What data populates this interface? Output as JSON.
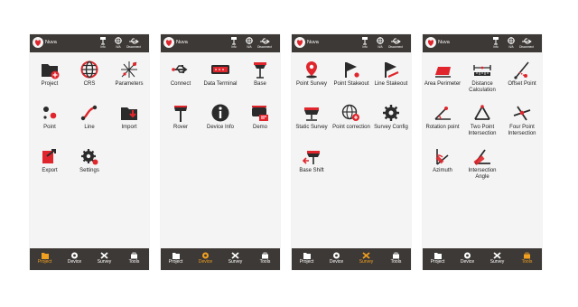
{
  "screens": [
    {
      "title": "Nuva",
      "header_buttons": [
        {
          "label": "Info",
          "icon": "tower-icon"
        },
        {
          "label": "N/A",
          "icon": "satellite-icon"
        },
        {
          "label": "Disconnect",
          "icon": "usb-icon"
        }
      ],
      "items": [
        {
          "label": "Project",
          "icon": "folder-add-icon"
        },
        {
          "label": "CRS",
          "icon": "globe-icon"
        },
        {
          "label": "Parameters",
          "icon": "parameters-icon"
        },
        {
          "label": "Point",
          "icon": "point-icon"
        },
        {
          "label": "Line",
          "icon": "line-icon"
        },
        {
          "label": "Import",
          "icon": "import-folder-icon"
        },
        {
          "label": "Export",
          "icon": "export-icon"
        },
        {
          "label": "Settings",
          "icon": "settings-gear-icon"
        }
      ],
      "active_tab": 0
    },
    {
      "title": "Nuva",
      "header_buttons": [
        {
          "label": "Info",
          "icon": "tower-icon"
        },
        {
          "label": "N/A",
          "icon": "satellite-icon"
        },
        {
          "label": "Disconnect",
          "icon": "usb-icon"
        }
      ],
      "items": [
        {
          "label": "Connect",
          "icon": "usb-connect-icon"
        },
        {
          "label": "Data Terminal",
          "icon": "terminal-icon"
        },
        {
          "label": "Base",
          "icon": "base-station-icon"
        },
        {
          "label": "Rover",
          "icon": "rover-icon"
        },
        {
          "label": "Device Info",
          "icon": "info-icon"
        },
        {
          "label": "Demo",
          "icon": "demo-icon"
        }
      ],
      "active_tab": 1
    },
    {
      "title": "Nuva",
      "header_buttons": [
        {
          "label": "Info",
          "icon": "tower-icon"
        },
        {
          "label": "N/A",
          "icon": "satellite-icon"
        },
        {
          "label": "Disconnect",
          "icon": "usb-icon"
        }
      ],
      "items": [
        {
          "label": "Point Survey",
          "icon": "map-pin-icon"
        },
        {
          "label": "Point Stakeout",
          "icon": "flag-stake-icon"
        },
        {
          "label": "Line Stakeout",
          "icon": "flag-line-icon"
        },
        {
          "label": "Static Survey",
          "icon": "static-survey-icon"
        },
        {
          "label": "Point correction",
          "icon": "point-correction-icon"
        },
        {
          "label": "Survey Config",
          "icon": "config-gear-icon"
        },
        {
          "label": "Base Shift",
          "icon": "base-shift-icon"
        }
      ],
      "active_tab": 2
    },
    {
      "title": "Nuva",
      "header_buttons": [
        {
          "label": "Info",
          "icon": "tower-icon"
        },
        {
          "label": "N/A",
          "icon": "satellite-icon"
        },
        {
          "label": "Disconnect",
          "icon": "usb-icon"
        }
      ],
      "items": [
        {
          "label": "Area Perimeter",
          "icon": "area-perimeter-icon"
        },
        {
          "label": "Distance Calculation",
          "icon": "distance-icon"
        },
        {
          "label": "Offset Point",
          "icon": "offset-point-icon"
        },
        {
          "label": "Rotation point",
          "icon": "rotation-point-icon"
        },
        {
          "label": "Two Point Intersection",
          "icon": "two-point-icon"
        },
        {
          "label": "Four Point Intersection",
          "icon": "four-point-icon"
        },
        {
          "label": "Azimuth",
          "icon": "azimuth-icon"
        },
        {
          "label": "Intersection Angle",
          "icon": "intersection-angle-icon"
        }
      ],
      "active_tab": 3
    }
  ],
  "tabs": [
    {
      "label": "Project",
      "icon": "folder-icon"
    },
    {
      "label": "Device",
      "icon": "device-icon"
    },
    {
      "label": "Survey",
      "icon": "survey-tools-icon"
    },
    {
      "label": "Tools",
      "icon": "toolbox-icon"
    }
  ],
  "colors": {
    "accent": "#f0a020",
    "bar": "#3d3936",
    "brand_red": "#e0262c",
    "icon_dark": "#2b2b2b"
  }
}
